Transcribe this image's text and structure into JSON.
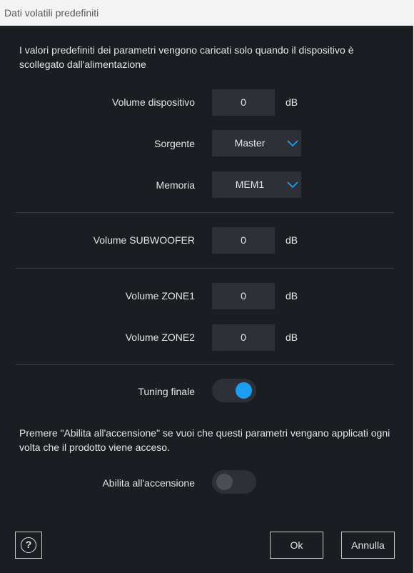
{
  "window": {
    "title": "Dati volatili predefiniti"
  },
  "intro_text": "I valori predefiniti dei parametri vengono caricati solo quando il dispositivo è scollegato dall'alimentazione",
  "fields": {
    "volume_device": {
      "label": "Volume dispositivo",
      "value": "0",
      "unit": "dB"
    },
    "source": {
      "label": "Sorgente",
      "value": "Master"
    },
    "memory": {
      "label": "Memoria",
      "value": "MEM1"
    },
    "volume_subwoofer": {
      "label": "Volume SUBWOOFER",
      "value": "0",
      "unit": "dB"
    },
    "volume_zone1": {
      "label": "Volume ZONE1",
      "value": "0",
      "unit": "dB"
    },
    "volume_zone2": {
      "label": "Volume ZONE2",
      "value": "0",
      "unit": "dB"
    }
  },
  "tuning": {
    "label": "Tuning finale",
    "state": "on"
  },
  "power_on_note": "Premere \"Abilita all'accensione\" se vuoi che questi parametri vengano applicati ogni volta che il prodotto viene acceso.",
  "enable_on_power": {
    "label": "Abilita all'accensione",
    "state": "off"
  },
  "buttons": {
    "help": "?",
    "ok": "Ok",
    "cancel": "Annulla"
  },
  "colors": {
    "accent": "#1e9ef0",
    "background": "#1a1d21",
    "field": "#2d3137"
  }
}
